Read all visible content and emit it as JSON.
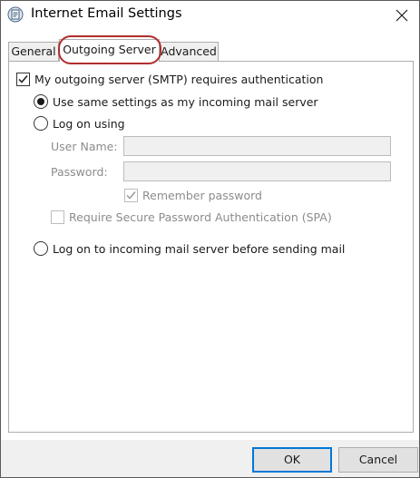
{
  "window": {
    "title": "Internet Email Settings"
  },
  "tabs": [
    {
      "label": "General",
      "active": false
    },
    {
      "label": "Outgoing Server",
      "active": true
    },
    {
      "label": "Advanced",
      "active": false
    }
  ],
  "outgoing": {
    "requires_auth_label": "My outgoing server (SMTP) requires authentication",
    "requires_auth_checked": true,
    "use_same_label": "Use same settings as my incoming mail server",
    "log_on_using_label": "Log on using",
    "user_name_label": "User Name:",
    "user_name_value": "",
    "password_label": "Password:",
    "password_value": "",
    "remember_password_label": "Remember password",
    "remember_password_checked": true,
    "spa_label": "Require Secure Password Authentication (SPA)",
    "spa_checked": false,
    "log_on_incoming_label": "Log on to incoming mail server before sending mail",
    "selected_option": "use_same"
  },
  "buttons": {
    "ok": "OK",
    "cancel": "Cancel"
  },
  "colors": {
    "highlight_ring": "#b22d2d",
    "default_button_border": "#0078d7",
    "disabled_text": "#8c8c8c"
  }
}
